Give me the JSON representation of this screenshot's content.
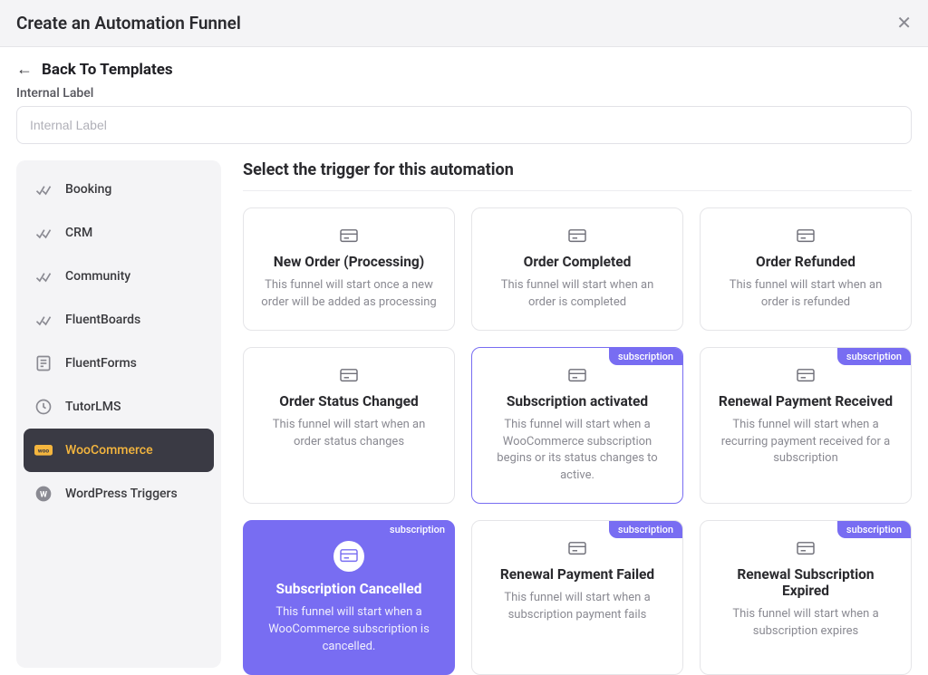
{
  "header": {
    "title": "Create an Automation Funnel"
  },
  "back": {
    "label": "Back To Templates"
  },
  "field": {
    "label": "Internal Label",
    "placeholder": "Internal Label",
    "value": ""
  },
  "sidebar": {
    "items": [
      {
        "label": "Booking",
        "icon": "check-icon"
      },
      {
        "label": "CRM",
        "icon": "check-icon"
      },
      {
        "label": "Community",
        "icon": "check-icon"
      },
      {
        "label": "FluentBoards",
        "icon": "check-icon"
      },
      {
        "label": "FluentForms",
        "icon": "form-icon"
      },
      {
        "label": "TutorLMS",
        "icon": "tutor-icon"
      },
      {
        "label": "WooCommerce",
        "icon": "woo-icon",
        "active": true
      },
      {
        "label": "WordPress Triggers",
        "icon": "wp-icon"
      }
    ]
  },
  "main": {
    "section_title": "Select the trigger for this automation",
    "badge_text": "subscription",
    "cards": [
      {
        "title": "New Order (Processing)",
        "desc": "This funnel will start once a new order will be added as processing"
      },
      {
        "title": "Order Completed",
        "desc": "This funnel will start when an order is completed"
      },
      {
        "title": "Order Refunded",
        "desc": "This funnel will start when an order is refunded"
      },
      {
        "title": "Order Status Changed",
        "desc": "This funnel will start when an order status changes"
      },
      {
        "title": "Subscription activated",
        "desc": "This funnel will start when a WooCommerce subscription begins or its status changes to active.",
        "badge": true,
        "highlight": true
      },
      {
        "title": "Renewal Payment Received",
        "desc": "This funnel will start when a recurring payment received for a subscription",
        "badge": true
      },
      {
        "title": "Subscription Cancelled",
        "desc": "This funnel will start when a WooCommerce subscription is cancelled.",
        "badge": true,
        "selected": true
      },
      {
        "title": "Renewal Payment Failed",
        "desc": "This funnel will start when a subscription payment fails",
        "badge": true
      },
      {
        "title": "Renewal Subscription Expired",
        "desc": "This funnel will start when a subscription expires",
        "badge": true
      }
    ]
  },
  "colors": {
    "accent": "#786df2",
    "sidebar_active_bg": "#3a3a44",
    "sidebar_active_fg": "#f5b63e"
  }
}
